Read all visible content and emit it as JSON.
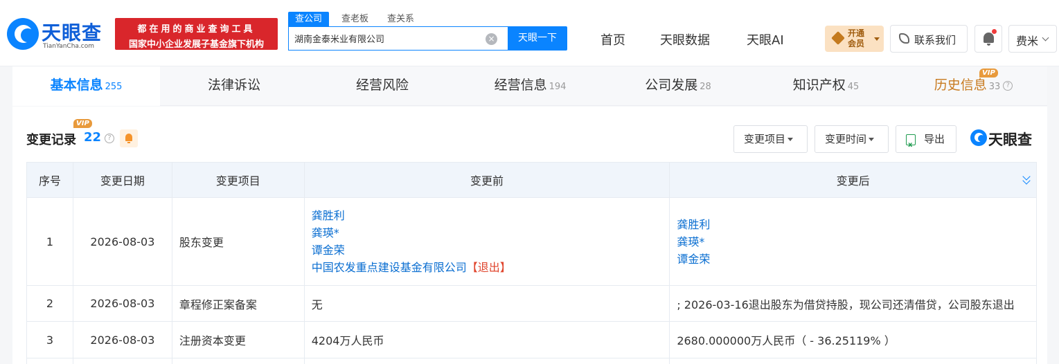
{
  "header": {
    "logo_text": "天眼查",
    "logo_sub": "TianYanCha.com",
    "slogan_line1": "都在用的商业查询工具",
    "slogan_line2": "国家中小企业发展子基金旗下机构",
    "search_tabs": [
      {
        "label": "查公司",
        "active": true
      },
      {
        "label": "查老板",
        "active": false
      },
      {
        "label": "查关系",
        "active": false
      }
    ],
    "search_value": "湖南金泰米业有限公司",
    "search_button": "天眼一下",
    "nav": [
      "首页",
      "天眼数据",
      "天眼AI"
    ],
    "vip_label": "开通会员",
    "contact_label": "联系我们",
    "user_name": "费米"
  },
  "tabs": [
    {
      "label": "基本信息",
      "count": "255",
      "active": true
    },
    {
      "label": "法律诉讼",
      "count": ""
    },
    {
      "label": "经营风险",
      "count": ""
    },
    {
      "label": "经营信息",
      "count": "194"
    },
    {
      "label": "公司发展",
      "count": "28"
    },
    {
      "label": "知识产权",
      "count": "45"
    },
    {
      "label": "历史信息",
      "count": "33",
      "vip": "VIP"
    }
  ],
  "section": {
    "title": "变更记录",
    "count": "22",
    "vip": "VIP",
    "filter_item": "变更项目",
    "filter_time": "变更时间",
    "export": "导出",
    "brand": "天眼查"
  },
  "table": {
    "headers": [
      "序号",
      "变更日期",
      "变更项目",
      "变更前",
      "变更后"
    ],
    "rows": [
      {
        "idx": "1",
        "date": "2026-08-03",
        "item": "股东变更",
        "before": [
          "龚胜利",
          "龚瑛*",
          "谭金荣",
          "中国农发重点建设基金有限公司"
        ],
        "before_exit": "【退出】",
        "after": [
          "龚胜利",
          "龚瑛*",
          "谭金荣"
        ]
      },
      {
        "idx": "2",
        "date": "2026-08-03",
        "item": "章程修正案备案",
        "before_text": "无",
        "after_text": "; 2026-03-16退出股东为借贷持股，现公司还清借贷，公司股东退出"
      },
      {
        "idx": "3",
        "date": "2026-08-03",
        "item": "注册资本变更",
        "before_text": "4204万人民币",
        "after_text": "2680.000000万人民币（ - 36.25119% ）"
      }
    ]
  },
  "colors": {
    "brand_blue": "#0a84ff",
    "link_blue": "#0a6ed1",
    "slogan_red": "#d9262b",
    "exit_red": "#e0452d",
    "increase_green": "#1ea74a",
    "history_gold": "#c87a1f"
  }
}
